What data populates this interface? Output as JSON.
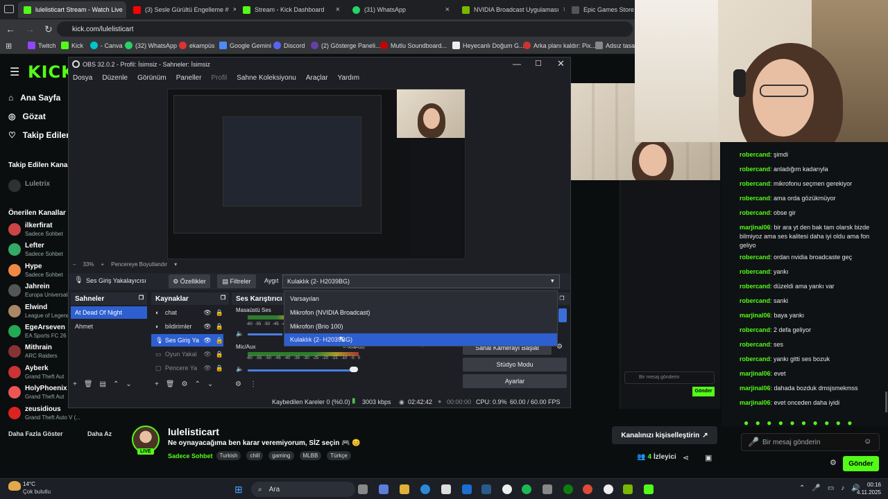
{
  "browser": {
    "tabs": [
      {
        "title": "lulelisticart Stream - Watch Live",
        "color": "#53fc18"
      },
      {
        "title": "(3) Sesle Gürültü Engelleme #",
        "color": "#ff0000"
      },
      {
        "title": "Stream - Kick Dashboard",
        "color": "#53fc18"
      },
      {
        "title": "(31) WhatsApp",
        "color": "#25d366"
      },
      {
        "title": "NVIDIA Broadcast Uygulaması",
        "color": "#76b900"
      },
      {
        "title": "Epic Games Store | P",
        "color": "#333333"
      }
    ],
    "url": "kick.com/lulelisticart",
    "bookmarks": [
      "Twitch",
      "Kick",
      "- Canva",
      "(32) WhatsApp",
      "ekampüs",
      "Google Gemini",
      "Discord",
      "(2) Gösterge Paneli...",
      "Mutlu Soundboard...",
      "Heyecanlı Doğum G...",
      "Arka planı kaldır: Pix...",
      "Adsız tasarı"
    ]
  },
  "kick": {
    "logo": "KICK",
    "nav": [
      "Ana Sayfa",
      "Gözat",
      "Takip Edilen"
    ],
    "followed_heading": "Takip Edilen Kanallar",
    "followed": [
      {
        "name": "Luletrix"
      }
    ],
    "recommended_heading": "Önerilen Kanallar",
    "channels": [
      {
        "name": "ilkerfirat",
        "game": "Sadece Sohbet"
      },
      {
        "name": "Lefter",
        "game": "Sadece Sohbet"
      },
      {
        "name": "Hype",
        "game": "Sadece Sohbet"
      },
      {
        "name": "Jahrein",
        "game": "Europa Universalis"
      },
      {
        "name": "Elwind",
        "game": "League of Legends"
      },
      {
        "name": "EgeArseven",
        "game": "EA Sports FC 26"
      },
      {
        "name": "Mithrain",
        "game": "ARC Raiders"
      },
      {
        "name": "Ayberk",
        "game": "Grand Theft Aut"
      },
      {
        "name": "HolyPhoenix",
        "game": "Grand Theft Aut"
      },
      {
        "name": "zeusidious",
        "game": "Grand Theft Auto V (..."
      }
    ],
    "more_label": "Daha Fazla Göster",
    "less_label": "Daha Az",
    "streamer": {
      "name": "lulelisticart",
      "title": "Ne oynayacağıma ben karar veremiyorum, SİZ seçin 🎮 😊",
      "category": "Sadece Sohbet",
      "tags": [
        "Turkish",
        "chill",
        "gaming",
        "MLBB",
        "Türkçe"
      ],
      "live": "LIVE",
      "customize": "Kanalınızı kişiselleştirin",
      "viewers": "4",
      "viewers_label": "İzleyici"
    },
    "chat_input_placeholder": "Bir mesaj gönderin",
    "send_label": "Gönder",
    "chat": [
      {
        "user": "robercand",
        "text": "şimdi"
      },
      {
        "user": "robercand",
        "text": "anladığım kadarıyla"
      },
      {
        "user": "robercand",
        "text": "mikrofonu seçmen gerekiyor"
      },
      {
        "user": "robercand",
        "text": "ama orda gözükmüyor"
      },
      {
        "user": "robercand",
        "text": "obse gir"
      },
      {
        "user": "marjinal06",
        "text": "bir ara yt den bak tam olarsk bizde bilmiyoz ama ses kalitesi daha iyi oldu ama fon geliyo"
      },
      {
        "user": "robercand",
        "text": "ordan nvidia broadcaste geç"
      },
      {
        "user": "robercand",
        "text": "yankı"
      },
      {
        "user": "robercand",
        "text": "düzeldi ama yankı var"
      },
      {
        "user": "robercand",
        "text": "sanki"
      },
      {
        "user": "marjinal06",
        "text": "baya yankı"
      },
      {
        "user": "robercand",
        "text": "2 defa geliyor"
      },
      {
        "user": "robercand",
        "text": "ses"
      },
      {
        "user": "robercand",
        "text": "yankı gitti ses bozuk"
      },
      {
        "user": "marjinal06",
        "text": "evet"
      },
      {
        "user": "marjinal06",
        "text": "dahada bozduk dmsjsmekmss"
      },
      {
        "user": "marjinal06",
        "text": "evet onceden daha iyidi"
      }
    ]
  },
  "obs": {
    "title": "OBS 32.0.2 - Profil: İsimsiz - Sahneler: İsimsiz",
    "menu": [
      "Dosya",
      "Düzenle",
      "Görünüm",
      "Paneller",
      "Profil",
      "Sahne Koleksiyonu",
      "Araçlar",
      "Yardım"
    ],
    "zoom": "33%",
    "fit_label": "Pencereye Boyutlandır",
    "source_name": "Ses Giriş Yakalayıcısı",
    "properties_label": "Özellikler",
    "filters_label": "Filtreler",
    "device_label": "Aygıt",
    "device_value": "Kulaklık (2- H2039BG)",
    "device_options": [
      "Varsayılan",
      "Mikrofon (NVIDIA Broadcast)",
      "Mikrofon (Brio 100)",
      "Kulaklık (2- H2039BG)"
    ],
    "scenes_title": "Sahneler",
    "scenes": [
      "At Dead Of Night",
      "Ahmet"
    ],
    "sources_title": "Kaynaklar",
    "sources": [
      "chat",
      "bildirimler",
      "Ses Giriş Ya",
      "Oyun Yakal",
      "Pencere Ya"
    ],
    "mixer_title": "Ses Karıştırıcı",
    "mixer": [
      {
        "name": "Masaüstü Ses",
        "level": "0.0 dB"
      },
      {
        "name": "Mic/Aux",
        "level": "0.0 dB"
      }
    ],
    "meter_ticks": [
      "-60",
      "-55",
      "-50",
      "-45",
      "-40",
      "-35",
      "-30",
      "-25",
      "-20",
      "-15",
      "-10",
      "-5",
      "0"
    ],
    "controls": [
      "Sanal Kamerayı Başlat",
      "Stüdyo Modu",
      "Ayarlar"
    ],
    "status": {
      "dropped": "Kaybedilen Kareler 0 (%0.0)",
      "bitrate": "3003 kbps",
      "live_time": "02:42:42",
      "rec_time": "00:00:00",
      "cpu": "CPU: 0.9%",
      "fps": "60.00 / 60.00 FPS"
    }
  },
  "taskbar": {
    "weather_temp": "14°C",
    "weather_desc": "Çok bulutlu",
    "search": "Ara",
    "time": "00:16",
    "date": "4.11.2025"
  }
}
